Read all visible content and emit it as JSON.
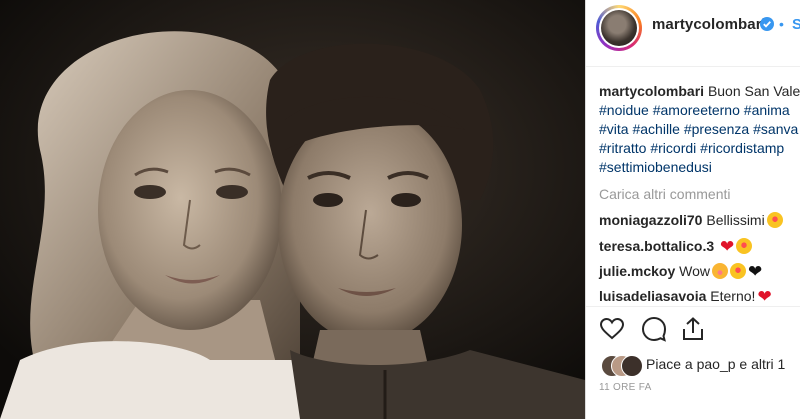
{
  "photo": {
    "alt_icon": "portrait-photo"
  },
  "header": {
    "username": "martycolombari",
    "verified_icon": "verified-badge-icon",
    "dot": "•",
    "follow_label": "S"
  },
  "caption": {
    "username": "martycolombari",
    "line1_text": "Buon San Vale",
    "line2": [
      "#noidue",
      "#amoreeterno",
      "#anima"
    ],
    "line3": [
      "#vita",
      "#achille",
      "#presenza",
      "#sanva"
    ],
    "line4": [
      "#ritratto",
      "#ricordi",
      "#ricordistamp"
    ],
    "line5": [
      "#settimiobenedusi"
    ]
  },
  "load_more": "Carica altri commenti",
  "comments": [
    {
      "user": "moniagazzoli70",
      "text": "Bellissimi",
      "emojis": [
        "star-struck"
      ]
    },
    {
      "user": "teresa.bottalico.3",
      "text": "",
      "emojis": [
        "red-heart",
        "star-struck"
      ]
    },
    {
      "user": "julie.mckoy",
      "text": "Wow",
      "emojis": [
        "blushing",
        "star-struck",
        "black-heart"
      ]
    },
    {
      "user": "luisadeliasavoia",
      "text": "Eterno!",
      "emojis": [
        "red-heart"
      ]
    }
  ],
  "actions": {
    "like_icon": "heart-icon",
    "comment_icon": "comment-icon",
    "share_icon": "share-icon"
  },
  "likes": {
    "text": "Piace a pao_p e altri 1"
  },
  "time": "11 ORE FA",
  "colors": {
    "link": "#3897f0",
    "hashtag": "#003569",
    "muted": "#999999",
    "text": "#262626"
  }
}
